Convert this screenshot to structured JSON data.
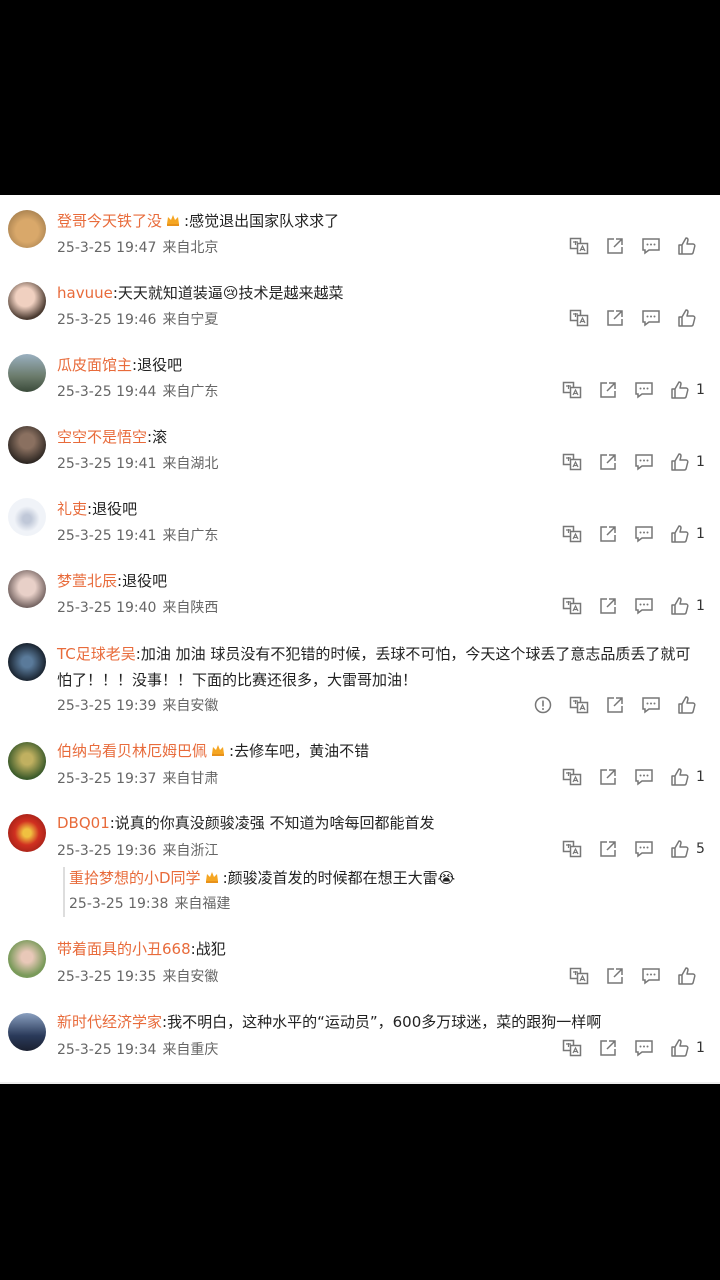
{
  "comments": [
    {
      "user": "登哥今天铁了没",
      "crown": true,
      "text": ":感觉退出国家队求求了",
      "time": "25-3-25 19:47",
      "loc": "来自北京",
      "likes": "",
      "avatar_color": "#c89a5c",
      "report": false
    },
    {
      "user": "havuue",
      "crown": false,
      "text": ":天天就知道装逼😢技术是越来越菜",
      "time": "25-3-25 19:46",
      "loc": "来自宁夏",
      "likes": "",
      "avatar_color": "#b88a6e",
      "report": false
    },
    {
      "user": "瓜皮面馆主",
      "crown": false,
      "text": ":退役吧",
      "time": "25-3-25 19:44",
      "loc": "来自广东",
      "likes": "1",
      "avatar_color": "#7a8a7a",
      "report": false
    },
    {
      "user": "空空不是悟空",
      "crown": false,
      "text": ":滚",
      "time": "25-3-25 19:41",
      "loc": "来自湖北",
      "likes": "1",
      "avatar_color": "#4a4038",
      "report": false
    },
    {
      "user": "礼吏",
      "crown": false,
      "text": ":退役吧",
      "time": "25-3-25 19:41",
      "loc": "来自广东",
      "likes": "1",
      "avatar_color": "#e8eef5",
      "report": false
    },
    {
      "user": "梦萱北辰",
      "crown": false,
      "text": ":退役吧",
      "time": "25-3-25 19:40",
      "loc": "来自陕西",
      "likes": "1",
      "avatar_color": "#8a7a78",
      "report": false
    },
    {
      "user": "TC足球老吴",
      "crown": false,
      "text": ":加油 加油   球员没有不犯错的时候，丢球不可怕，今天这个球丢了意志品质丢了就可怕了！！！没事！！下面的比赛还很多，大雷哥加油！",
      "time": "25-3-25 19:39",
      "loc": "来自安徽",
      "likes": "",
      "avatar_color": "#2c3a4a",
      "report": true
    },
    {
      "user": "伯纳乌看贝林厄姆巴佩",
      "crown": true,
      "text": ":去修车吧，黄油不错",
      "time": "25-3-25 19:37",
      "loc": "来自甘肃",
      "likes": "1",
      "avatar_color": "#6a7a3a",
      "report": false
    },
    {
      "user": "DBQ01",
      "crown": false,
      "text": ":说真的你真没颜骏凌强 不知道为啥每回都能首发",
      "time": "25-3-25 19:36",
      "loc": "来自浙江",
      "likes": "5",
      "avatar_color": "#c83a2a",
      "report": false
    },
    {
      "user": "带着面具的小丑668",
      "crown": false,
      "text": ":战犯",
      "time": "25-3-25 19:35",
      "loc": "来自安徽",
      "likes": "",
      "avatar_color": "#7a9a5a",
      "report": false
    },
    {
      "user": "新时代经济学家",
      "crown": false,
      "text": ":我不明白，这种水平的“运动员”，600多万球迷，菜的跟狗一样啊",
      "time": "25-3-25 19:34",
      "loc": "来自重庆",
      "likes": "1",
      "avatar_color": "#3a4a6a",
      "report": false
    }
  ],
  "reply": {
    "user": "重拾梦想的小D同学",
    "crown": true,
    "text": ":颜骏凌首发的时候都在想王大雷😭",
    "time": "25-3-25 19:38",
    "loc": "来自福建"
  },
  "icons": [
    "translate-icon",
    "share-icon",
    "comment-icon",
    "like-icon",
    "report-icon",
    "crown-icon"
  ]
}
